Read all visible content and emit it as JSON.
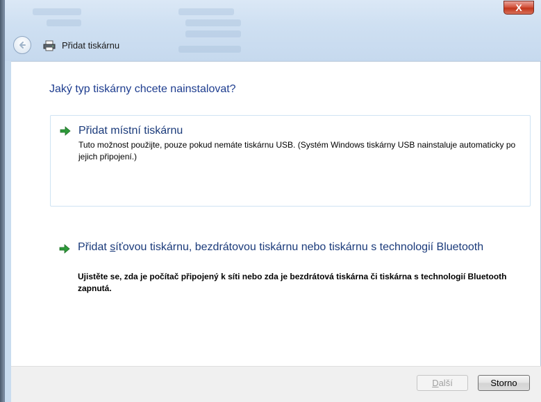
{
  "window": {
    "close_label": "X",
    "breadcrumb": "Přidat tiskárnu"
  },
  "main": {
    "heading": "Jaký typ tiskárny chcete nainstalovat?",
    "options": [
      {
        "title": "Přidat místní tiskárnu",
        "description": "Tuto možnost použijte, pouze pokud nemáte tiskárnu USB. (Systém Windows tiskárny USB nainstaluje automaticky po jejich připojení.)"
      },
      {
        "title_prefix": "Přidat ",
        "title_underlined": "s",
        "title_rest": "íťovou tiskárnu, bezdrátovou tiskárnu nebo tiskárnu s technologií Bluetooth",
        "description": "Ujistěte se, zda je počítač připojený k síti nebo zda je bezdrátová tiskárna či tiskárna s technologií Bluetooth zapnutá."
      }
    ]
  },
  "footer": {
    "next_underlined": "D",
    "next_rest": "alší",
    "cancel_label": "Storno"
  },
  "colors": {
    "heading": "#1e3d8f",
    "arrow": "#2e9a3a",
    "close_button": "#c2361c"
  },
  "icons": [
    "back-arrow-icon",
    "printer-icon",
    "green-arrow-icon"
  ]
}
